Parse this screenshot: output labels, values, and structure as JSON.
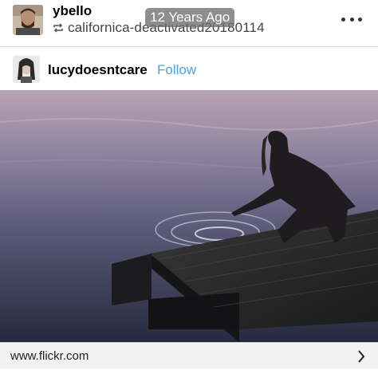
{
  "post": {
    "username": "ybello",
    "reblogged_from": "californica-deactivated20180114",
    "timestamp": "12 Years Ago",
    "icons": {
      "reblog": "reblog-icon",
      "more": "more-options-icon"
    }
  },
  "source": {
    "username": "lucydoesntcare",
    "follow_label": "Follow",
    "follow_color": "#4aa3df"
  },
  "link": {
    "url": "www.flickr.com",
    "icon": "chevron-right-icon"
  }
}
